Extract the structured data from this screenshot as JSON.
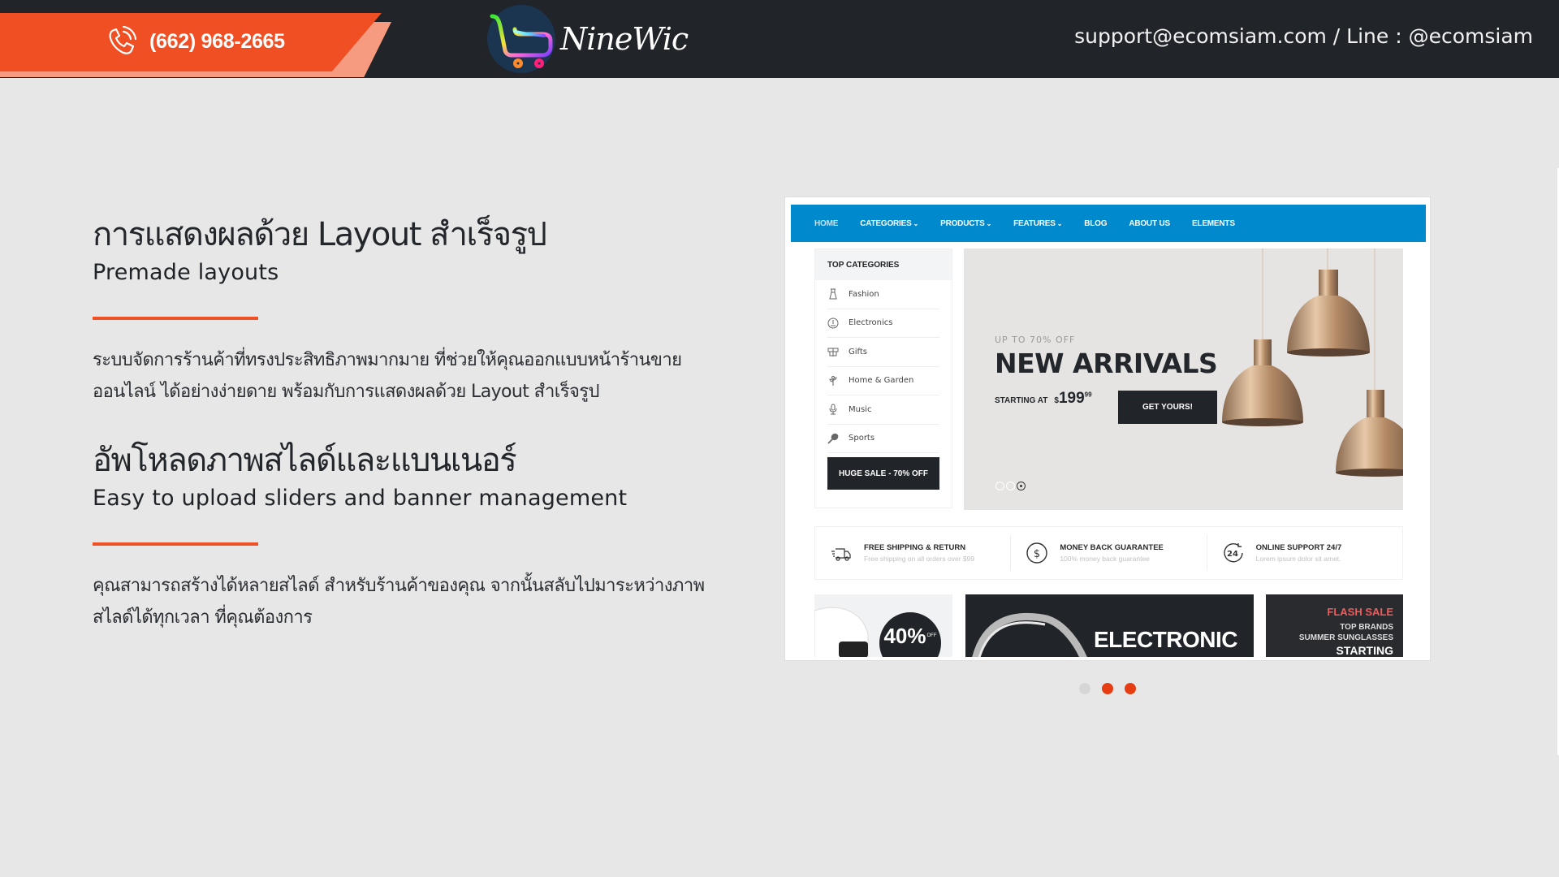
{
  "header": {
    "phone": "(662) 968-2665",
    "phone_icon": "phone-ringing-icon",
    "logo_text": "NineWic",
    "logo_icon": "shopping-cart-icon",
    "contact": "support@ecomsiam.com / Line : @ecomsiam",
    "colors": {
      "bar": "#212429",
      "ribbon": "#f04f24",
      "ribbon_shadow": "#f69a80"
    }
  },
  "sections": [
    {
      "title": "การแสดงผลด้วย Layout สำเร็จรูป",
      "subtitle": "Premade layouts",
      "body_line1": "ระบบจัดการร้านค้าที่ทรงประสิทธิภาพมากมาย ที่ช่วยให้คุณออกแบบหน้าร้านขาย",
      "body_line2": "ออนไลน์ ได้อย่างง่ายดาย พร้อมกับการแสดงผลด้วย Layout สำเร็จรูป"
    },
    {
      "title": "อัพโหลดภาพสไลด์และแบนเนอร์",
      "subtitle": "Easy to upload sliders and banner management",
      "body_line1": "คุณสามารถสร้างได้หลายสไลด์ สำหรับร้านค้าของคุณ จากนั้นสลับไปมาระหว่างภาพ",
      "body_line2": "สไลด์ได้ทุกเวลา ที่คุณต้องการ"
    }
  ],
  "accent_color": "#ef5125",
  "preview": {
    "nav": [
      {
        "label": "HOME",
        "dropdown": false
      },
      {
        "label": "CATEGORIES",
        "dropdown": true
      },
      {
        "label": "PRODUCTS",
        "dropdown": true
      },
      {
        "label": "FEATURES",
        "dropdown": true
      },
      {
        "label": "BLOG",
        "dropdown": false
      },
      {
        "label": "ABOUT US",
        "dropdown": false
      },
      {
        "label": "ELEMENTS",
        "dropdown": false
      }
    ],
    "nav_color": "#0089cc",
    "categories_title": "TOP CATEGORIES",
    "categories": [
      {
        "label": "Fashion",
        "icon": "dress-icon"
      },
      {
        "label": "Electronics",
        "icon": "gauge-icon"
      },
      {
        "label": "Gifts",
        "icon": "gift-icon"
      },
      {
        "label": "Home & Garden",
        "icon": "plant-icon"
      },
      {
        "label": "Music",
        "icon": "microphone-icon"
      },
      {
        "label": "Sports",
        "icon": "tennis-racket-icon"
      }
    ],
    "huge_sale": "HUGE SALE - 70% OFF",
    "hero": {
      "kicker": "UP TO 70% OFF",
      "title": "NEW ARRIVALS",
      "price_label": "STARTING AT",
      "price_currency": "$",
      "price_main": "199",
      "price_cents": "99",
      "button": "GET YOURS!",
      "slide_count": 3,
      "active_slide": 3
    },
    "features": [
      {
        "title": "FREE SHIPPING & RETURN",
        "desc": "Free shipping on all orders over $99",
        "icon": "truck-icon"
      },
      {
        "title": "MONEY BACK GUARANTEE",
        "desc": "100% money back guarantee",
        "icon": "dollar-circle-icon"
      },
      {
        "title": "ONLINE SUPPORT 24/7",
        "desc": "Lorem ipsum dolor sit amet.",
        "icon": "support-24-icon"
      }
    ],
    "promos": {
      "a_badge": "40%",
      "a_badge_sub": "OFF",
      "b_title": "ELECTRONIC",
      "c_line1": "FLASH SALE",
      "c_line2": "TOP BRANDS",
      "c_line3": "SUMMER SUNGLASSES",
      "c_line4": "STARTING"
    }
  },
  "carousel": {
    "count": 3,
    "states": [
      "inactive",
      "active",
      "active"
    ],
    "active_color": "#e63d12",
    "inactive_color": "#d6d6d6"
  }
}
